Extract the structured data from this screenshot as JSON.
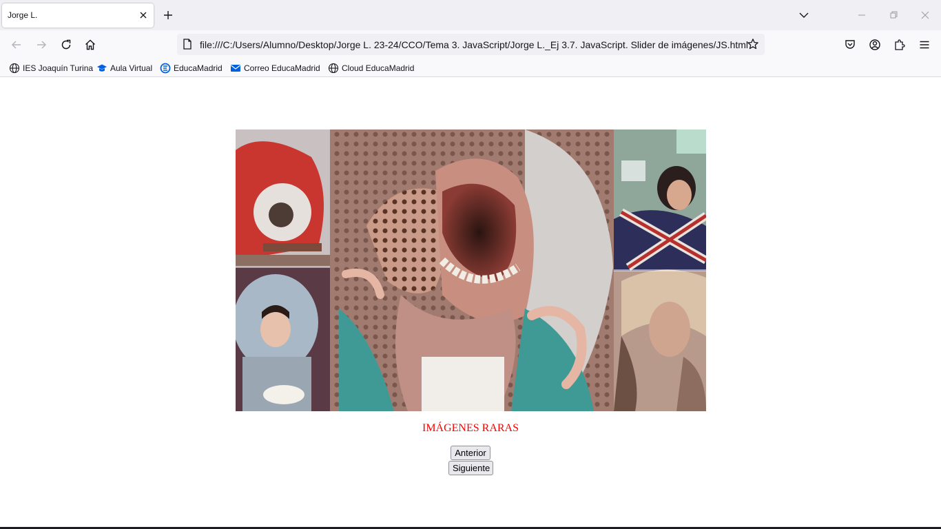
{
  "browser": {
    "tab_title": "Jorge L.",
    "url": "file:///C:/Users/Alumno/Desktop/Jorge L. 23-24/CCO/Tema 3. JavaScript/Jorge L._Ej 3.7. JavaScript. Slider de imágenes/JS.html",
    "bookmarks": [
      {
        "label": "IES Joaquín Turina",
        "icon": "globe-icon"
      },
      {
        "label": "Aula Virtual",
        "icon": "graduation-cap-icon"
      },
      {
        "label": "EducaMadrid",
        "icon": "educamadrid-icon"
      },
      {
        "label": "Correo EducaMadrid",
        "icon": "mail-icon"
      },
      {
        "label": "Cloud EducaMadrid",
        "icon": "globe-icon"
      }
    ],
    "accent_color": "#0060df"
  },
  "page": {
    "caption": "IMÁGENES RARAS",
    "caption_color": "#ff0000",
    "prev_label": "Anterior",
    "next_label": "Siguiente"
  }
}
